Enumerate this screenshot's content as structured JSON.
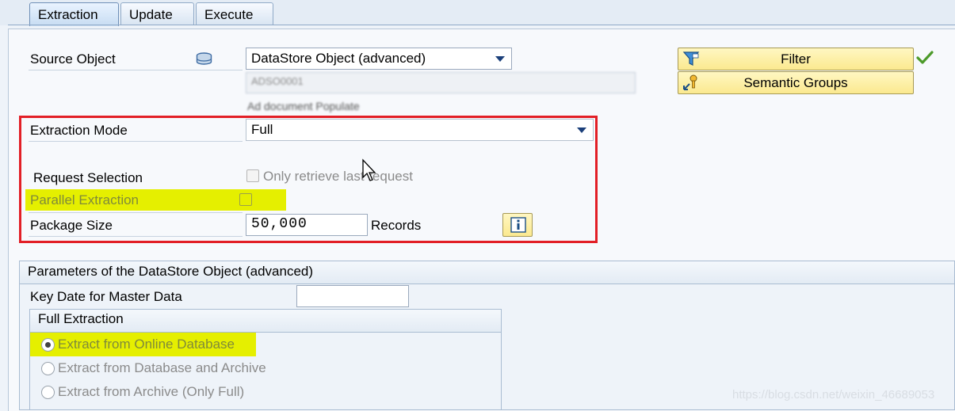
{
  "tabs": [
    "Extraction",
    "Update",
    "Execute"
  ],
  "source_object": {
    "label": "Source Object",
    "type_value": "DataStore Object (advanced)",
    "name_value": "ADSO0001",
    "description": "Ad document Populate"
  },
  "buttons": {
    "filter": "Filter",
    "semantic_groups": "Semantic Groups"
  },
  "extraction_mode": {
    "label": "Extraction Mode",
    "value": "Full"
  },
  "request_selection": {
    "label": "Request Selection",
    "checkbox_label": "Only retrieve last request"
  },
  "parallel_extraction": {
    "label": "Parallel Extraction"
  },
  "package_size": {
    "label": "Package Size",
    "value": "50,000",
    "unit": "Records"
  },
  "parameters": {
    "title": "Parameters of the DataStore Object (advanced)",
    "key_date_label": "Key Date for Master Data",
    "key_date_value": ""
  },
  "full_extraction": {
    "title": "Full Extraction",
    "options": [
      "Extract from Online Database",
      "Extract from Database and Archive",
      "Extract from Archive (Only Full)"
    ],
    "selected_index": 0
  },
  "watermark": "https://blog.csdn.net/weixin_46689053",
  "colors": {
    "highlight_red": "#e21f26",
    "highlight_yellow": "#e5ef00",
    "button_yellow": "#fbe98f"
  },
  "icons": [
    "database-icon",
    "filter-icon",
    "semantic-groups-icon",
    "checkmark-icon",
    "info-icon",
    "mouse-cursor-icon"
  ]
}
